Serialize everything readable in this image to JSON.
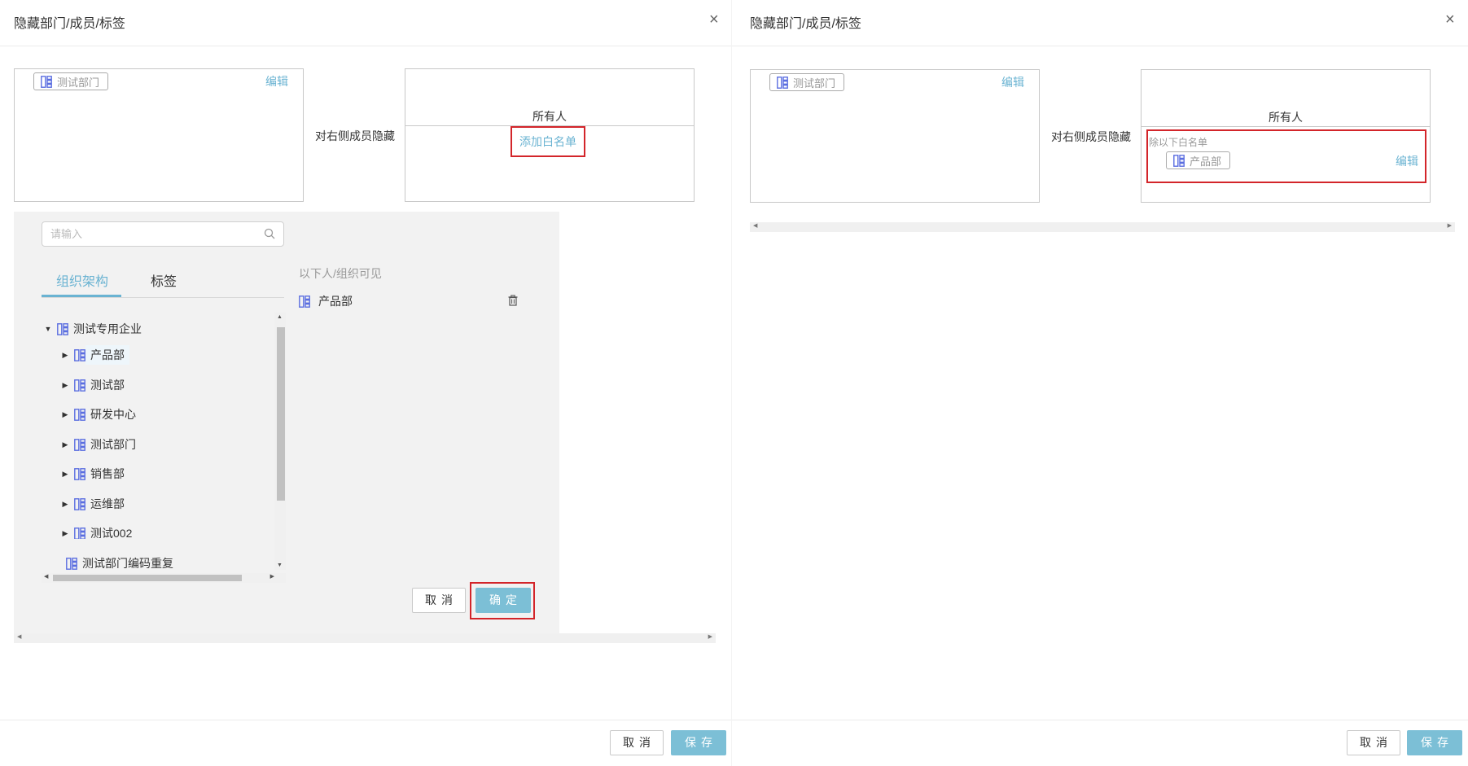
{
  "left_dialog": {
    "title": "隐藏部门/成员/标签",
    "close_glyph": "×",
    "hidden_dept_tag": "测试部门",
    "edit_label": "编辑",
    "hide_from_label": "对右侧成员隐藏",
    "all_members_label": "所有人",
    "add_whitelist_label": "添加白名单",
    "picker": {
      "search_placeholder": "请输入",
      "tabs": [
        "组织架构",
        "标签"
      ],
      "tree": {
        "root": "测试专用企业",
        "children": [
          "产品部",
          "测试部",
          "研发中心",
          "测试部门",
          "销售部",
          "运维部",
          "测试002"
        ],
        "sibling": "测试部门编码重复"
      },
      "visible_title": "以下人/组织可见",
      "selected_items": [
        "产品部"
      ],
      "cancel_label": "取消",
      "ok_label": "确定"
    },
    "footer": {
      "cancel_label": "取消",
      "save_label": "保存"
    }
  },
  "right_dialog": {
    "title": "隐藏部门/成员/标签",
    "close_glyph": "×",
    "hidden_dept_tag": "测试部门",
    "edit_label": "编辑",
    "hide_from_label": "对右侧成员隐藏",
    "all_members_label": "所有人",
    "whitelist_title": "除以下白名单",
    "whitelist_tag": "产品部",
    "whitelist_edit_label": "编辑",
    "footer": {
      "cancel_label": "取消",
      "save_label": "保存"
    }
  },
  "colors": {
    "accent": "#6ab3d2",
    "primary_button": "#7cbfd6",
    "highlight_frame": "#d3252a",
    "dept_icon": "#5b6ee0"
  },
  "icons": {
    "dept": "department-icon",
    "search": "search-icon",
    "trash": "trash-icon",
    "close": "close-icon",
    "caret_down": "caret-down-icon",
    "caret_right": "caret-right-icon"
  }
}
